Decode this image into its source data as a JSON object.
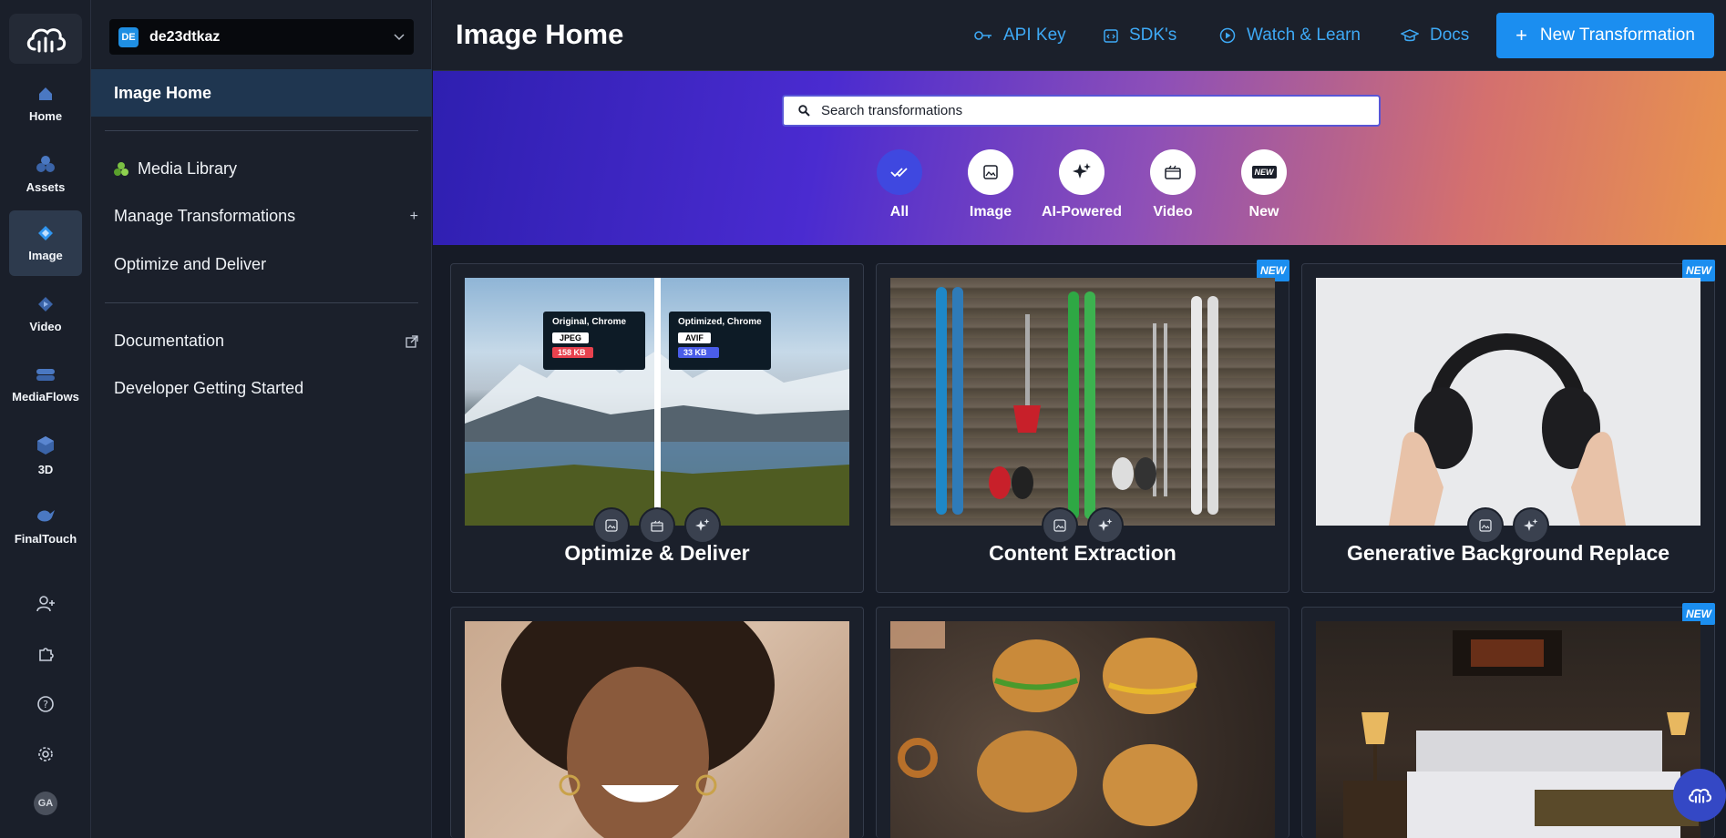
{
  "rail": {
    "items": [
      {
        "label": "Home",
        "icon": "home-icon"
      },
      {
        "label": "Assets",
        "icon": "assets-icon"
      },
      {
        "label": "Image",
        "icon": "image-diamond-icon",
        "active": true
      },
      {
        "label": "Video",
        "icon": "video-icon"
      },
      {
        "label": "MediaFlows",
        "icon": "mediaflows-icon"
      },
      {
        "label": "3D",
        "icon": "cube-icon"
      },
      {
        "label": "FinalTouch",
        "icon": "finaltouch-icon"
      }
    ],
    "avatar_initials": "GA"
  },
  "panel": {
    "account_badge": "DE",
    "account_name": "de23dtkaz",
    "active_item": "Image Home",
    "links": {
      "media_library": "Media Library",
      "manage_transformations": "Manage Transformations",
      "optimize": "Optimize and Deliver",
      "documentation": "Documentation",
      "getting_started": "Developer Getting Started"
    }
  },
  "header": {
    "title": "Image Home",
    "api_key": "API Key",
    "sdks": "SDK's",
    "watch_learn": "Watch & Learn",
    "docs": "Docs",
    "new_transformation": "New Transformation"
  },
  "hero": {
    "search_placeholder": "Search transformations",
    "filters": [
      "All",
      "Image",
      "AI-Powered",
      "Video",
      "New"
    ]
  },
  "cards": [
    {
      "title": "Optimize & Deliver",
      "new": false
    },
    {
      "title": "Content Extraction",
      "new": true
    },
    {
      "title": "Generative Background Replace",
      "new": true
    },
    {
      "title": "",
      "new": false
    },
    {
      "title": "",
      "new": false
    },
    {
      "title": "",
      "new": true
    }
  ],
  "optimize_card": {
    "left_label": "Original, Chrome",
    "left_format": "JPEG",
    "left_size": "158 KB",
    "right_label": "Optimized, Chrome",
    "right_format": "AVIF",
    "right_size": "33 KB"
  },
  "badge_text": "NEW",
  "colors": {
    "accent": "#1b8ef0",
    "link": "#3ea9f5",
    "active_nav": "#1f3650",
    "size_bad": "#e8424e",
    "size_good": "#4a5de8"
  }
}
